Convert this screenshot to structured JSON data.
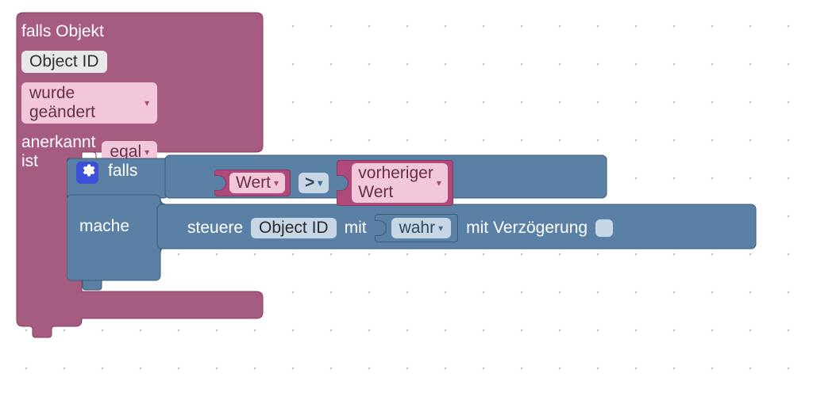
{
  "event": {
    "header": "falls Objekt",
    "object_id": "Object ID",
    "change_mode": "wurde geändert",
    "ack_label": "anerkannt ist",
    "ack_value": "egal"
  },
  "if_block": {
    "falls": "falls",
    "mache": "mache",
    "left_value": "Wert",
    "operator": ">",
    "right_value": "vorheriger Wert"
  },
  "control": {
    "verb": "steuere",
    "object_id": "Object ID",
    "with": "mit",
    "value": "wahr",
    "delay_label": "mit Verzögerung",
    "delay_checked": false
  },
  "colors": {
    "purple": "#a65b81",
    "purple_dark": "#8b3960",
    "purple_light": "#f1c7d9",
    "blue": "#5b80a5",
    "blue_dark": "#3d5b78",
    "blue_light": "#c7d6e5",
    "gear": "#3b4fd8"
  }
}
